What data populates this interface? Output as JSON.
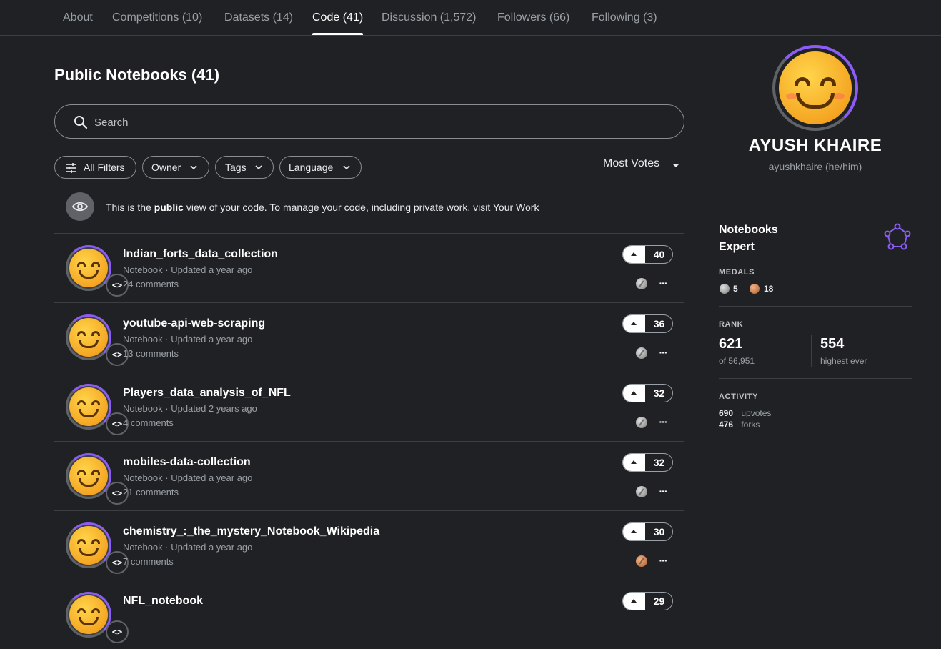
{
  "tabs": [
    {
      "label": "About"
    },
    {
      "label": "Competitions (10)"
    },
    {
      "label": "Datasets (14)"
    },
    {
      "label": "Code (41)",
      "active": true
    },
    {
      "label": "Discussion (1,572)"
    },
    {
      "label": "Followers (66)"
    },
    {
      "label": "Following (3)"
    }
  ],
  "main": {
    "title": "Public Notebooks (41)",
    "search_placeholder": "Search",
    "filters": {
      "all": "All Filters",
      "owner": "Owner",
      "tags": "Tags",
      "language": "Language"
    },
    "sort_label": "Most Votes",
    "notice": {
      "prefix": "This is the ",
      "bold": "public",
      "middle": " view of your code. To manage your code, including private work, visit ",
      "link": "Your Work"
    },
    "notebooks": [
      {
        "title": "Indian_forts_data_collection",
        "meta": "Notebook · Updated a year ago",
        "comments": "24 comments",
        "votes": "40",
        "medal": "silver",
        "code_glyph": "<>"
      },
      {
        "title": "youtube-api-web-scraping",
        "meta": "Notebook · Updated a year ago",
        "comments": "13 comments",
        "votes": "36",
        "medal": "silver",
        "code_glyph": "<>"
      },
      {
        "title": "Players_data_analysis_of_NFL",
        "meta": "Notebook · Updated 2 years ago",
        "comments": "4 comments",
        "votes": "32",
        "medal": "silver",
        "code_glyph": "<>"
      },
      {
        "title": "mobiles-data-collection",
        "meta": "Notebook · Updated a year ago",
        "comments": "21 comments",
        "votes": "32",
        "medal": "silver",
        "code_glyph": "<>"
      },
      {
        "title": "chemistry_:_the_mystery_Notebook_Wikipedia",
        "meta": "Notebook · Updated a year ago",
        "comments": "7 comments",
        "votes": "30",
        "medal": "bronze",
        "code_glyph": "<>"
      },
      {
        "title": "NFL_notebook",
        "meta": "",
        "comments": "",
        "votes": "29",
        "medal": "",
        "code_glyph": "<>"
      }
    ]
  },
  "profile": {
    "name": "AYUSH KHAIRE",
    "handle": "ayushkhaire (he/him)",
    "tier_line1": "Notebooks",
    "tier_line2": "Expert",
    "medals_label": "MEDALS",
    "silver_count": "5",
    "bronze_count": "18",
    "rank_label": "RANK",
    "rank": "621",
    "rank_of": "of 56,951",
    "highest": "554",
    "highest_label": "highest ever",
    "activity_label": "ACTIVITY",
    "upvotes": "690",
    "upvotes_label": "upvotes",
    "forks": "476",
    "forks_label": "forks"
  },
  "colors": {
    "background": "#202124",
    "accent": "#8b5cf6",
    "silver": "#9e9e9e",
    "bronze": "#c77b4a"
  },
  "icons": [
    "search-icon",
    "filter-sliders-icon",
    "chevron-down-icon",
    "eye-icon",
    "code-icon",
    "upvote-icon",
    "more-icon",
    "expert-tier-icon"
  ]
}
